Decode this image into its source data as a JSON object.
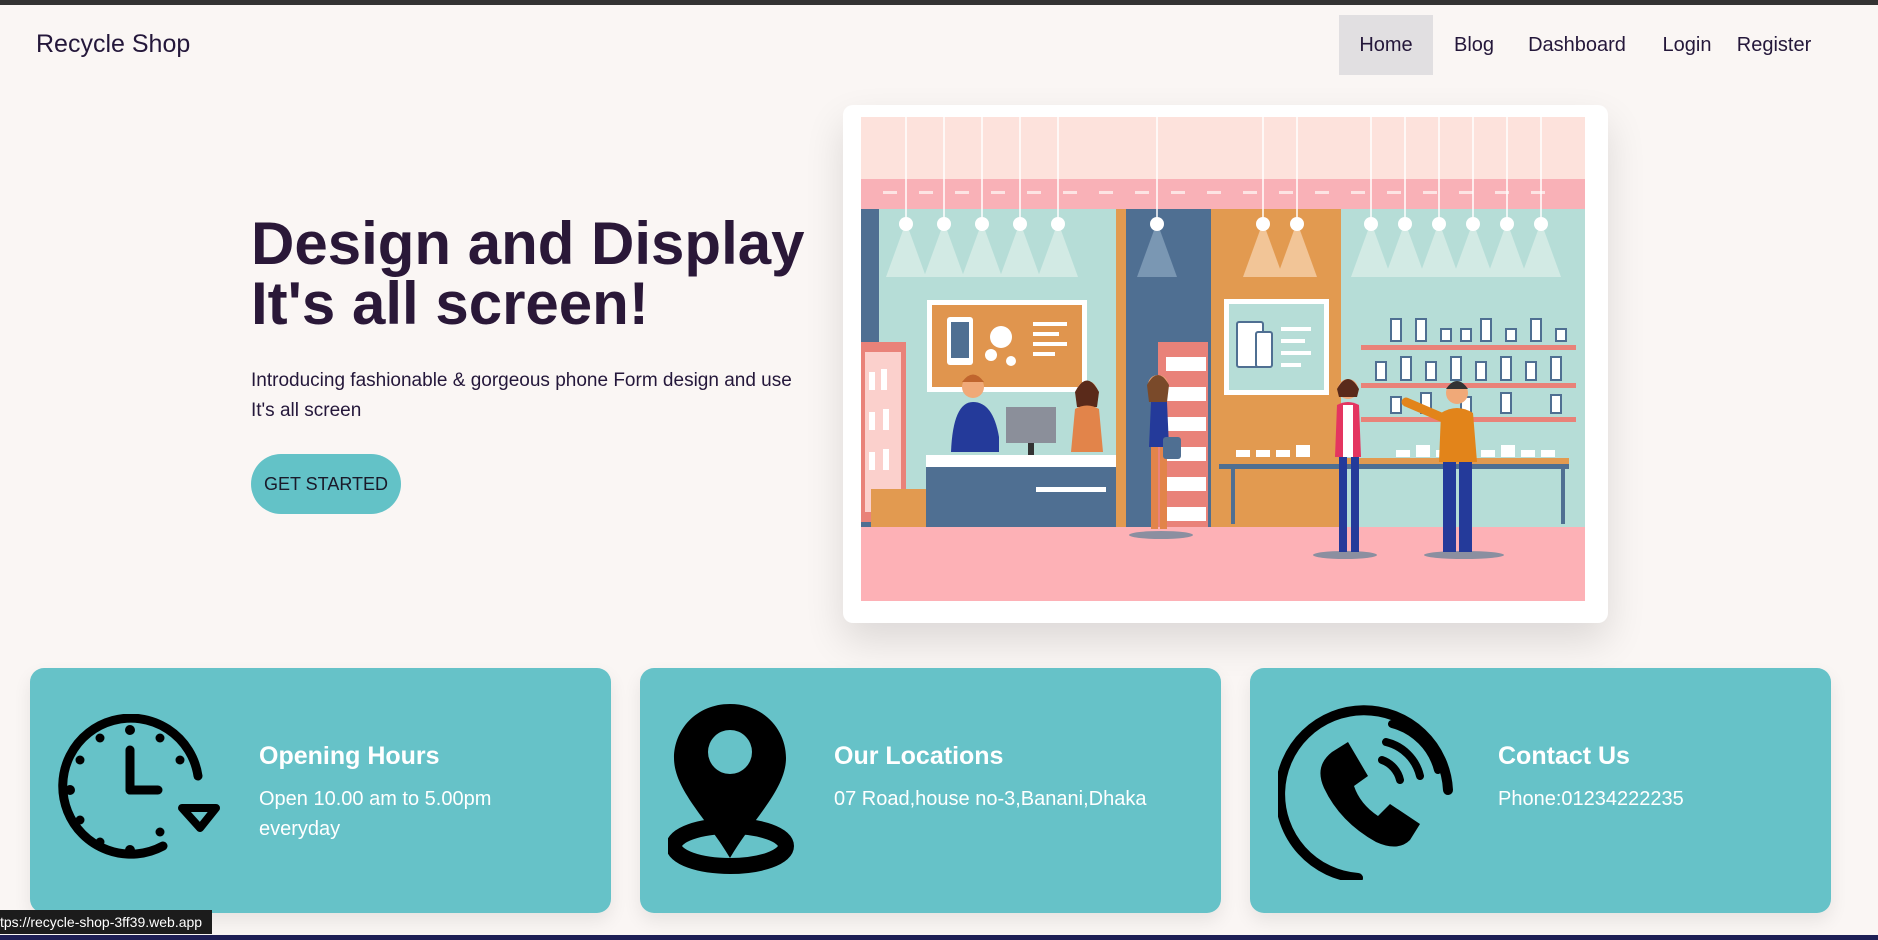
{
  "brand": "Recycle Shop",
  "nav": {
    "home": "Home",
    "blog": "Blog",
    "dashboard": "Dashboard",
    "login": "Login",
    "register": "Register",
    "active": "Home"
  },
  "hero": {
    "title_line1": "Design and Display",
    "title_line2": "It's all screen!",
    "desc_line1": "Introducing fashionable & gorgeous phone Form design and use",
    "desc_line2": "It's all screen",
    "cta_label": "GET STARTED",
    "illustration": "phone-shop-illustration"
  },
  "cards": [
    {
      "icon": "clock-icon",
      "title": "Opening Hours",
      "text_line1": "Open 10.00 am to 5.00pm",
      "text_line2": "everyday"
    },
    {
      "icon": "location-pin-icon",
      "title": "Our Locations",
      "text_line1": "07 Road,house no-3,Banani,Dhaka",
      "text_line2": ""
    },
    {
      "icon": "phone-icon",
      "title": "Contact Us",
      "text_line1": "Phone:01234222235",
      "text_line2": ""
    }
  ],
  "status_bar": "tps://recycle-shop-3ff39.web.app",
  "colors": {
    "background": "#faf6f4",
    "accent_teal": "#66c2c8",
    "heading": "#2a1838",
    "nav_active_bg": "#e1dfe1"
  }
}
